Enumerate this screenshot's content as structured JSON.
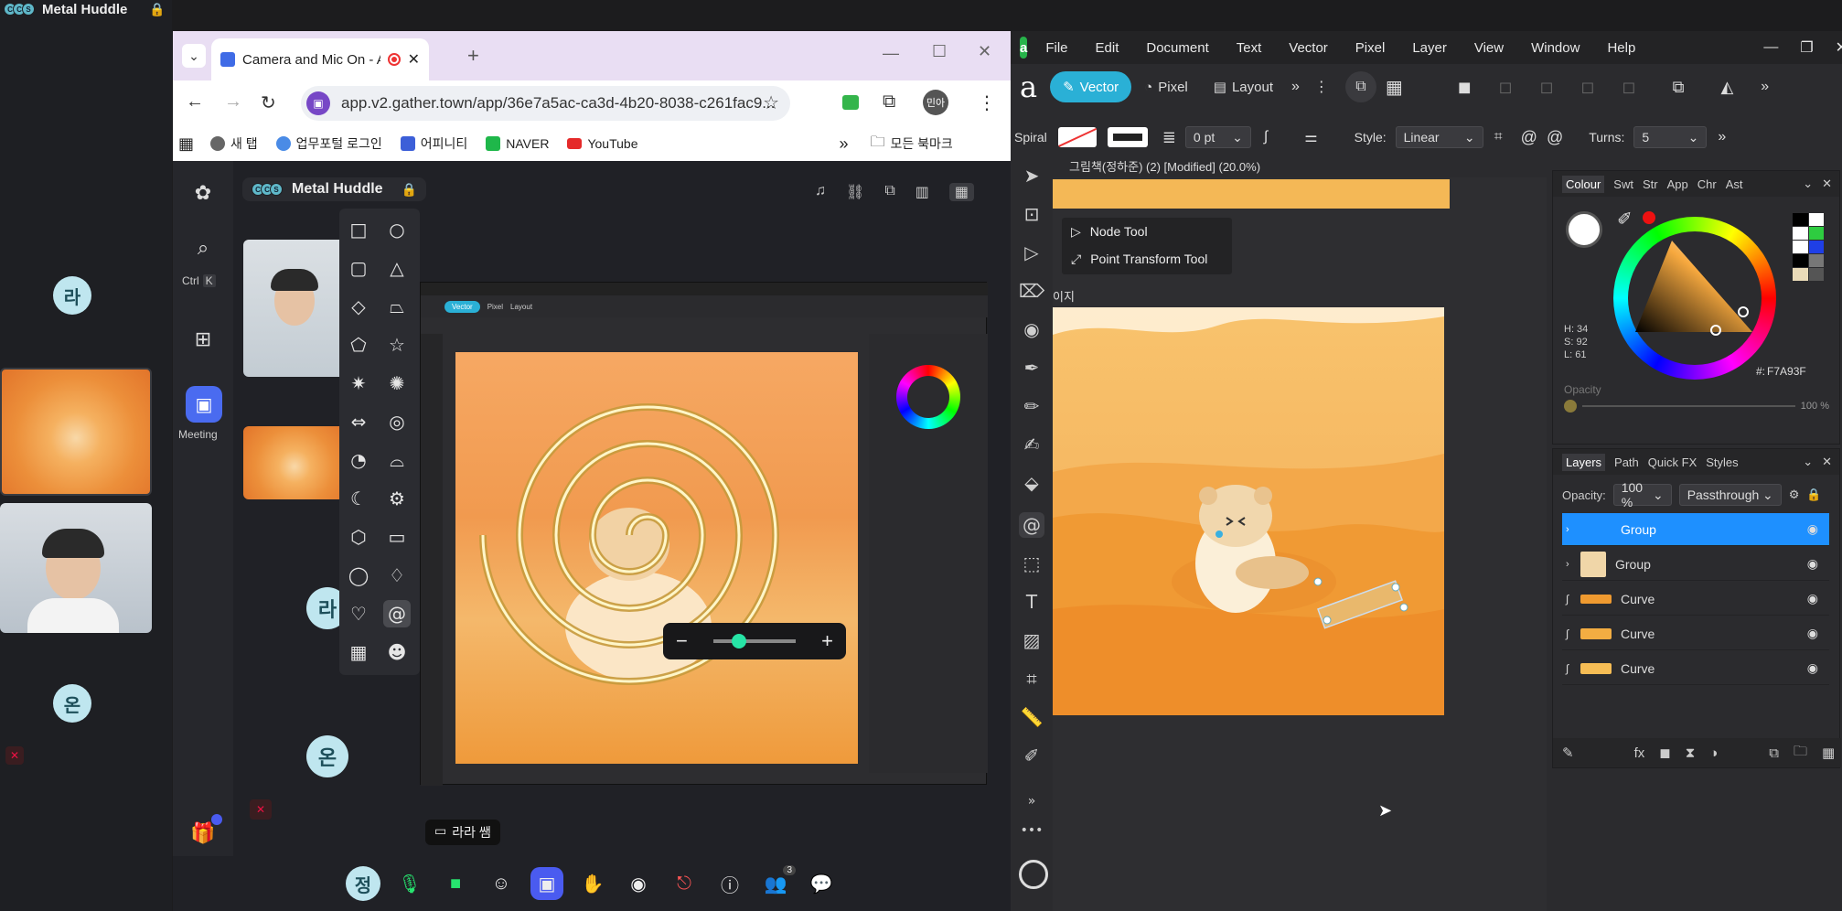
{
  "left": {
    "huddle_title": "Metal Huddle",
    "avatar_ra": "라",
    "avatar_on": "온",
    "dots": [
      "C",
      "C",
      "S"
    ]
  },
  "browser": {
    "tab_title": "Camera and Mic On - Affi",
    "new_tab": "+",
    "url": "app.v2.gather.town/app/36e7a5ac-ca3d-4b20-8038-c261fac9...",
    "profile": "민아",
    "bookmarks": [
      "새 탭",
      "업무포털 로그인",
      "어피니티",
      "NAVER",
      "YouTube"
    ],
    "all_bookmarks": "모든 북마크"
  },
  "gather": {
    "huddle_title": "Metal Huddle",
    "search_shortcut": [
      "Ctrl",
      "K"
    ],
    "meeting_label": "Meeting",
    "avatar_ra": "라",
    "avatar_on": "온",
    "screen_share_label": "라라 쌤",
    "self_avatar": "정",
    "participants_count": "3"
  },
  "affinity": {
    "menu": [
      "File",
      "Edit",
      "Document",
      "Text",
      "Vector",
      "Pixel",
      "Layer",
      "View",
      "Window",
      "Help"
    ],
    "personas": [
      "Vector",
      "Pixel",
      "Layout"
    ],
    "tool_name": "Spiral",
    "stroke_width": "0 pt",
    "style_label": "Style:",
    "style_value": "Linear",
    "turns_label": "Turns:",
    "turns_value": "5",
    "doc_title": "그림책(정하준) (2) [Modified] (20.0%)",
    "flyout": [
      "Node Tool",
      "Point Transform Tool"
    ],
    "canvas_label": "이지",
    "colour_tabs": [
      "Colour",
      "Swt",
      "Str",
      "App",
      "Chr",
      "Ast"
    ],
    "hsl": [
      "H: 34",
      "S: 92",
      "L: 61"
    ],
    "hex": "F7A93F",
    "opacity_label": "Opacity",
    "opacity_pct": "100 %",
    "layers_tabs": [
      "Layers",
      "Path",
      "Quick FX",
      "Styles"
    ],
    "layers_opacity_label": "Opacity:",
    "layers_opacity": "100 %",
    "blend_mode": "Passthrough",
    "layers": [
      {
        "name": "Group",
        "selected": true
      },
      {
        "name": "Group",
        "selected": false
      },
      {
        "name": "Curve",
        "selected": false
      },
      {
        "name": "Curve",
        "selected": false
      },
      {
        "name": "Curve",
        "selected": false
      }
    ],
    "colors": {
      "accent": "#1e90ff",
      "persona_active": "#2ab0d6",
      "wheel_marker": "#f7a93f"
    }
  }
}
